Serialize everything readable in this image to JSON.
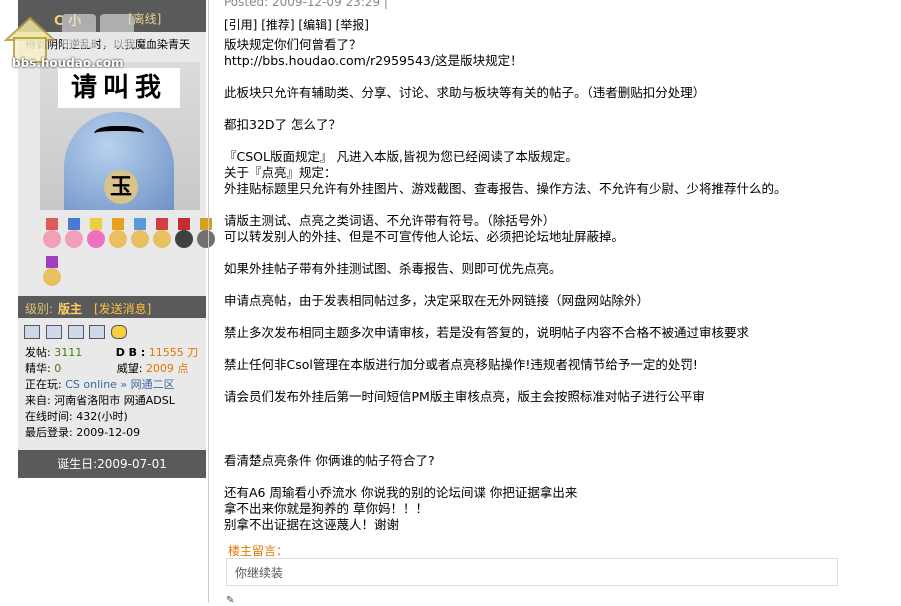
{
  "site": {
    "logo_url": "bbs.houdao.com"
  },
  "user": {
    "name": "C 小",
    "status_tag": "[离线]",
    "signature": "待到阴阳逆乱时，以我魔血染青天",
    "avatar_text_top": "请叫我",
    "avatar_text_bottom": "玉",
    "level_label": "级别:",
    "level_value": "版主",
    "send_message": "[发送消息]",
    "posts_label": "发帖:",
    "posts_value": "3111",
    "db_label": "D B :",
    "db_value": "11555 刀",
    "essence_label": "精华:",
    "essence_value": "0",
    "prestige_label": "威望:",
    "prestige_value": "2009 点",
    "playing_label": "正在玩:",
    "playing_value": "CS online » 网通二区",
    "from_label": "来自:",
    "from_value": "河南省洛阳市 网通ADSL",
    "online_label": "在线时间:",
    "online_value": "432(小时)",
    "last_login_label": "最后登录:",
    "last_login_value": "2009-12-09",
    "birthday": "诞生日:2009-07-01"
  },
  "post": {
    "posted": "Posted: 2009-12-09 23:29 |",
    "actions": [
      "[引用]",
      "[推荐]",
      "[编辑]",
      "[举报]"
    ],
    "lines": [
      "版块规定你们何曾看了？",
      "http://bbs.houdao.com/r2959543/这是版块规定！",
      "",
      "此板块只允许有辅助类、分享、讨论、求助与板块等有关的帖子。（违者删贴扣分处理）",
      "",
      "都扣32D了  怎么了？",
      "",
      "『CSOL版面规定』 凡进入本版,皆视为您已经阅读了本版规定。",
      "关于『点亮』规定：",
      "外挂贴标题里只允许有外挂图片、游戏截图、查毒报告、操作方法、不允许有少尉、少将推荐什么的。",
      "",
      "请版主测试、点亮之类词语、不允许带有符号。（除括号外）",
      "可以转发别人的外挂、但是不可宣传他人论坛、必须把论坛地址屏蔽掉。",
      "",
      "如果外挂帖子带有外挂测试图、杀毒报告、则即可优先点亮。",
      "",
      "申请点亮帖，由于发表相同帖过多，决定采取在无外网链接（网盘网站除外）",
      "",
      "禁止多次发布相同主题多次申请审核，若是没有答复的，说明帖子内容不合格不被通过审核要求",
      "",
      "禁止任何非Csol管理在本版进行加分或者点亮移贴操作!违规者视情节给予一定的处罚!",
      "",
      "请会员们发布外挂后第一时间短信PM版主审核点亮，版主会按照标准对帖子进行公平审",
      "",
      "",
      "",
      "看清楚点亮条件  你俩谁的帖子符合了?",
      "",
      "还有A6 周瑜看小乔流水  你说我的别的论坛间谍  你把证据拿出来",
      "拿不出来你就是狗养的  草你妈！！！",
      "别拿不出证据在这诬蔑人！谢谢"
    ],
    "owner_label": "楼主留言：",
    "owner_text": "你继续装"
  },
  "colors": {
    "panel_dark": "#5a5a5a",
    "panel_light": "#e9e9e9",
    "accent_orange": "#e07800"
  }
}
